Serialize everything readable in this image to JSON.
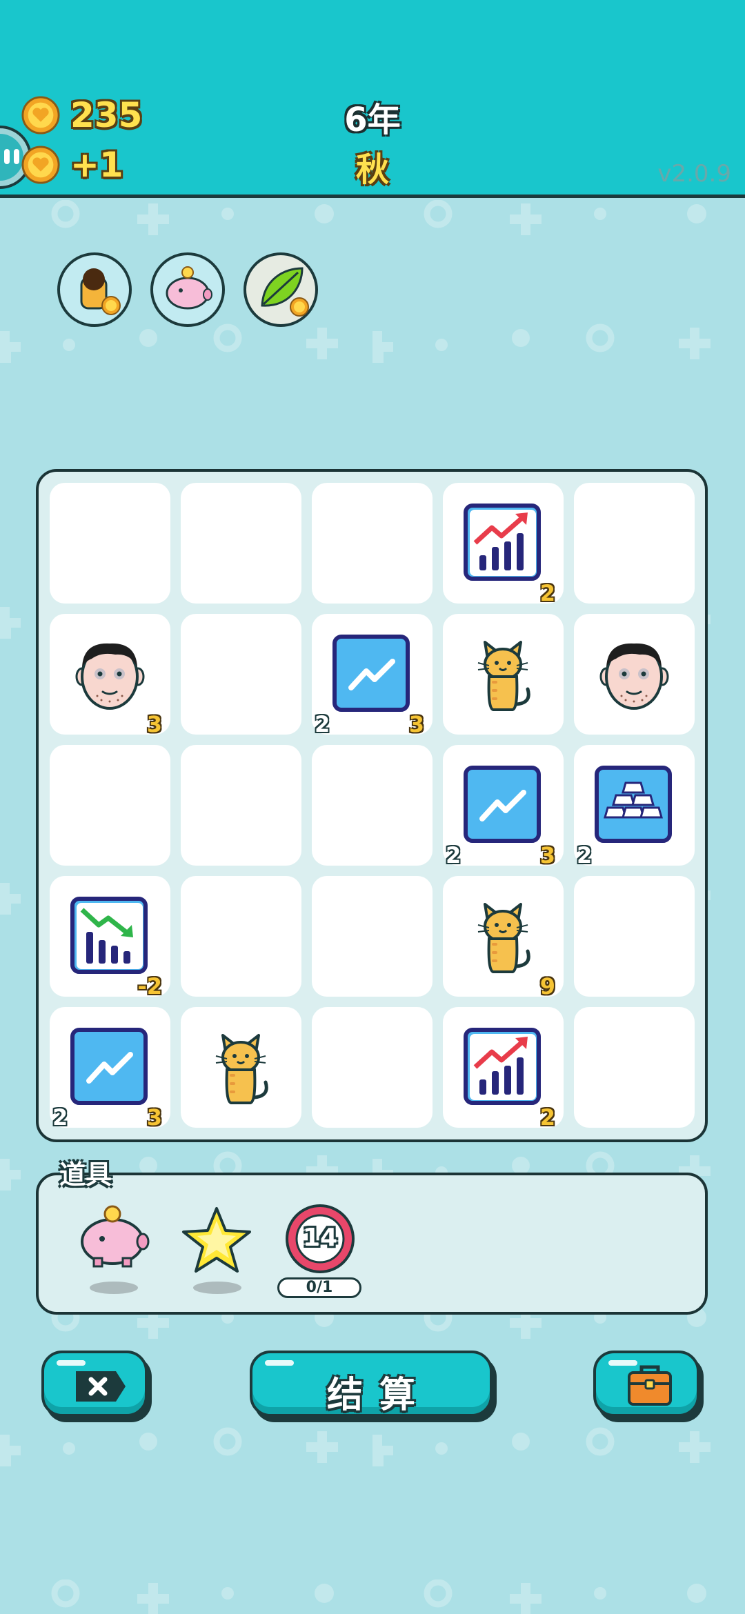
{
  "header": {
    "coins": "235",
    "income": "+1",
    "year": "6年",
    "season": "秋",
    "version": "v2.0.9"
  },
  "owned_items": [
    {
      "icon": "cat-with-coin-icon"
    },
    {
      "icon": "piggy-bank-icon"
    },
    {
      "icon": "leaf-with-coin-icon"
    }
  ],
  "board": {
    "rows": [
      [
        {
          "icon": ""
        },
        {
          "icon": ""
        },
        {
          "icon": ""
        },
        {
          "icon": "chart-up-icon",
          "value": "2"
        },
        {
          "icon": ""
        }
      ],
      [
        {
          "icon": "face-icon",
          "value": "3"
        },
        {
          "icon": ""
        },
        {
          "icon": "trend-line-icon",
          "value": "3",
          "counter": "2"
        },
        {
          "icon": "cat-icon"
        },
        {
          "icon": "face-icon"
        }
      ],
      [
        {
          "icon": ""
        },
        {
          "icon": ""
        },
        {
          "icon": ""
        },
        {
          "icon": "trend-line-icon",
          "value": "3",
          "counter": "2"
        },
        {
          "icon": "gold-bars-icon",
          "counter": "2"
        }
      ],
      [
        {
          "icon": "chart-down-icon",
          "value": "-2"
        },
        {
          "icon": ""
        },
        {
          "icon": ""
        },
        {
          "icon": "cat-icon",
          "value": "9"
        },
        {
          "icon": ""
        }
      ],
      [
        {
          "icon": "trend-line-icon",
          "value": "3",
          "counter": "2"
        },
        {
          "icon": "cat-icon"
        },
        {
          "icon": ""
        },
        {
          "icon": "chart-up-icon",
          "value": "2"
        },
        {
          "icon": ""
        }
      ]
    ]
  },
  "tools": {
    "title": "道具",
    "items": [
      {
        "icon": "piggy-bank-icon"
      },
      {
        "icon": "star-icon"
      },
      {
        "icon": "roulette-icon",
        "number": "14",
        "counter": "0/1"
      }
    ]
  },
  "buttons": {
    "skip_icon": "close-tag-icon",
    "settle_label": "结算",
    "bag_icon": "briefcase-icon"
  },
  "colors": {
    "topbar": "#19c6cc",
    "background": "#ace0e6",
    "coin": "#ffe14f",
    "outline": "#1c3a3c"
  }
}
